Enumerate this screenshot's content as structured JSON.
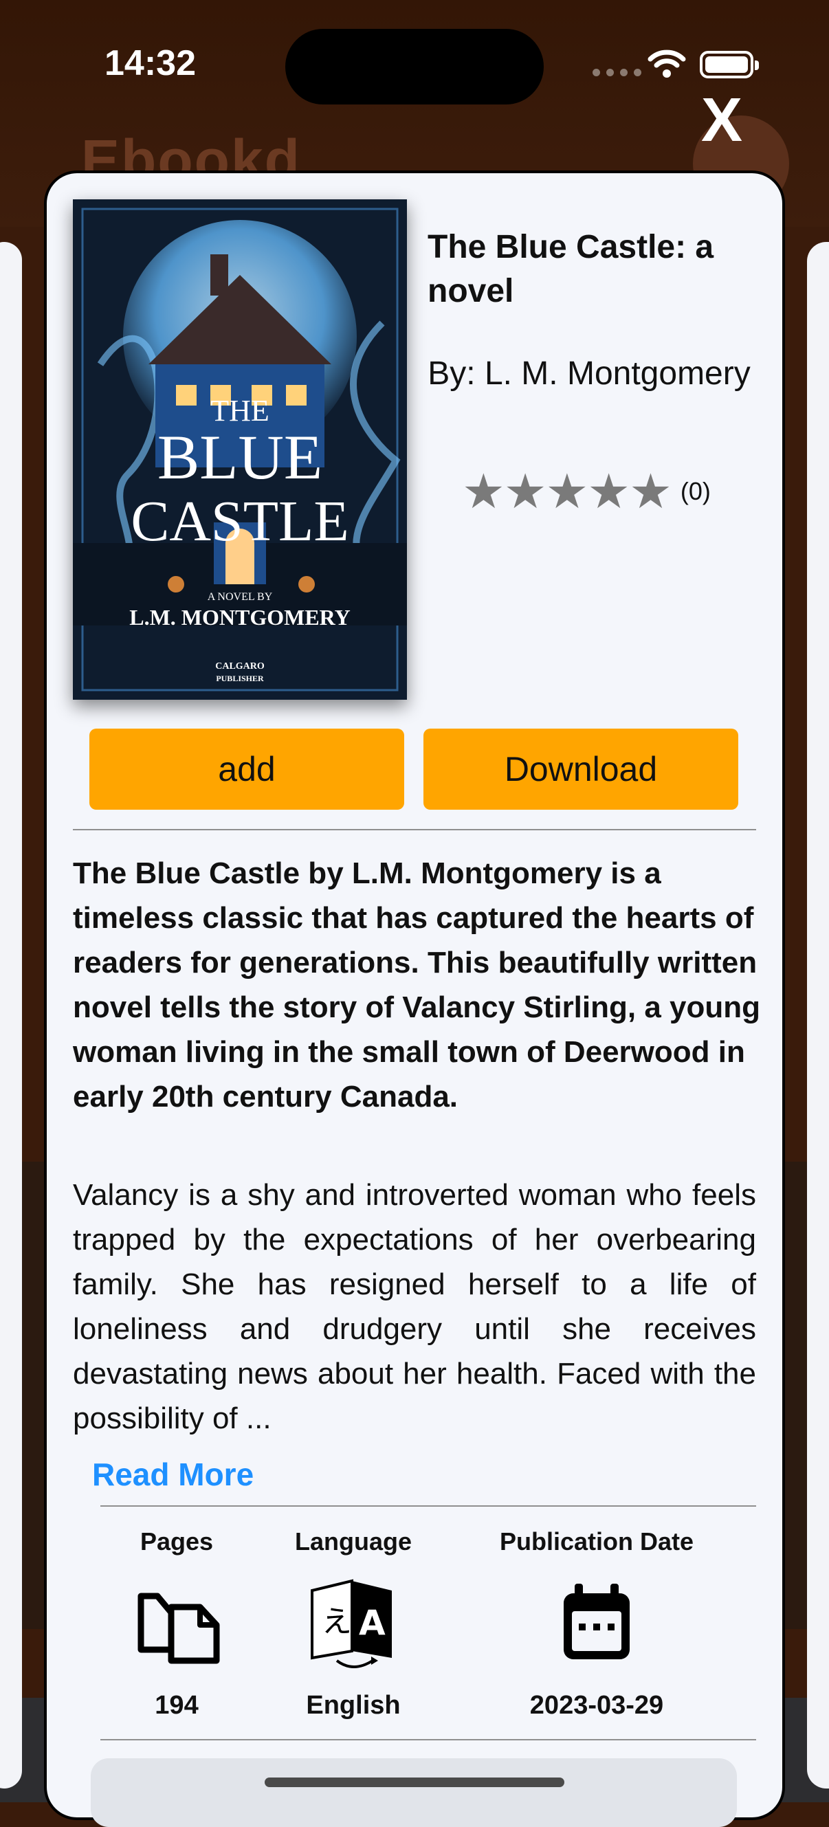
{
  "status_bar": {
    "time": "14:32"
  },
  "background": {
    "title": "Ebookd"
  },
  "close_label": "X",
  "book": {
    "title": "The Blue Castle: a novel",
    "author": "By: L. M. Montgomery",
    "rating": 0,
    "rating_count": "(0)",
    "cover": {
      "line1": "THE",
      "line2": "BLUE",
      "line3": "CASTLE",
      "subtitle": "A NOVEL BY",
      "author": "L.M. MONTGOMERY",
      "publisher_line1": "CALGARO",
      "publisher_line2": "PUBLISHER"
    }
  },
  "actions": {
    "add": "add",
    "download": "Download"
  },
  "description": {
    "bold": "The Blue Castle by L.M. Montgomery is a timeless classic that has captured the hearts of readers for generations. This beautifully written novel tells the story of Valancy Stirling, a young woman living in the small town of Deerwood in early 20th century Canada.",
    "normal": "Valancy is a shy and introverted woman who feels trapped by the expectations of her overbearing family. She has resigned herself to a life of loneliness and drudgery until she receives devastating news about her health. Faced with the possibility of ...",
    "read_more": "Read More"
  },
  "details": {
    "pages": {
      "label": "Pages",
      "value": "194",
      "icon": "pages-icon"
    },
    "language": {
      "label": "Language",
      "value": "English",
      "icon": "translate-icon"
    },
    "publication_date": {
      "label": "Publication Date",
      "value": "2023-03-29",
      "icon": "calendar-icon"
    }
  },
  "colors": {
    "accent": "#ffa500",
    "link": "#1e90ff",
    "sheet": "#f4f6fb",
    "star": "#7a7a7a"
  }
}
